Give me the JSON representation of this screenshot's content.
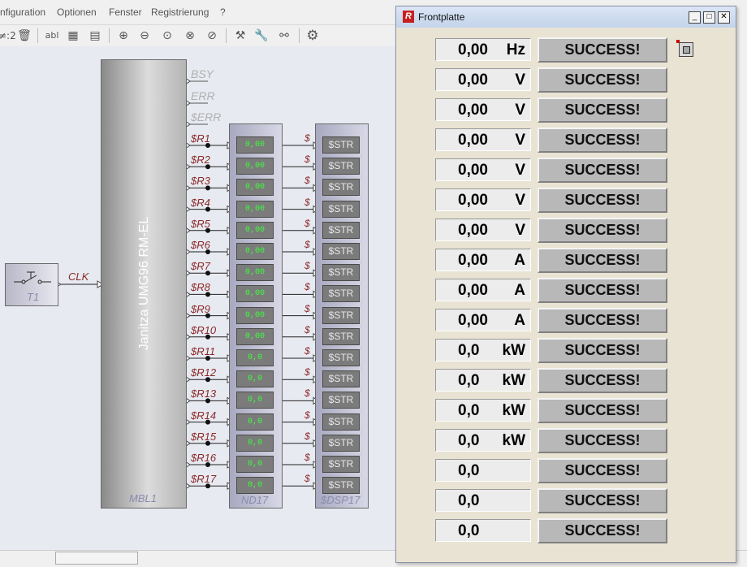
{
  "menubar": {
    "items": [
      "nfiguration",
      "Optionen",
      "Fenster",
      "Registrierung",
      "?"
    ]
  },
  "toolbar": {
    "zoom_label": "≠:2",
    "text_tool_label": "abl"
  },
  "canvas": {
    "switch_block": {
      "label": "T1",
      "output": "CLK"
    },
    "main_block": {
      "title": "Janitza UMG96 RM-EL",
      "label": "MBL1"
    },
    "status_signals": [
      "BSY",
      "ERR",
      "$ERR"
    ],
    "output_signals": [
      "$R1",
      "$R2",
      "$R3",
      "$R4",
      "$R5",
      "$R6",
      "$R7",
      "$R8",
      "$R9",
      "$R10",
      "$R11",
      "$R12",
      "$R13",
      "$R14",
      "$R15",
      "$R16",
      "$R17"
    ],
    "nd_block": {
      "label": "ND17",
      "cells": [
        "0,00",
        "0,00",
        "0,00",
        "0,00",
        "0,00",
        "0,00",
        "0,00",
        "0,00",
        "0,00",
        "0,00",
        "0,0",
        "0,0",
        "0,0",
        "0,0",
        "0,0",
        "0,0",
        "0,0"
      ]
    },
    "dsp_block": {
      "label": "$DSP17",
      "cell_text": "$STR",
      "input_label": "$"
    }
  },
  "frontplatte": {
    "title": "Frontplatte",
    "window_buttons": {
      "minimize": "_",
      "maximize": "□",
      "close": "✕"
    },
    "rows": [
      {
        "value": "0,00",
        "unit": "Hz",
        "status": "SUCCESS!"
      },
      {
        "value": "0,00",
        "unit": "V",
        "status": "SUCCESS!"
      },
      {
        "value": "0,00",
        "unit": "V",
        "status": "SUCCESS!"
      },
      {
        "value": "0,00",
        "unit": "V",
        "status": "SUCCESS!"
      },
      {
        "value": "0,00",
        "unit": "V",
        "status": "SUCCESS!"
      },
      {
        "value": "0,00",
        "unit": "V",
        "status": "SUCCESS!"
      },
      {
        "value": "0,00",
        "unit": "V",
        "status": "SUCCESS!"
      },
      {
        "value": "0,00",
        "unit": "A",
        "status": "SUCCESS!"
      },
      {
        "value": "0,00",
        "unit": "A",
        "status": "SUCCESS!"
      },
      {
        "value": "0,00",
        "unit": "A",
        "status": "SUCCESS!"
      },
      {
        "value": "0,0",
        "unit": "kW",
        "status": "SUCCESS!"
      },
      {
        "value": "0,0",
        "unit": "kW",
        "status": "SUCCESS!"
      },
      {
        "value": "0,0",
        "unit": "kW",
        "status": "SUCCESS!"
      },
      {
        "value": "0,0",
        "unit": "kW",
        "status": "SUCCESS!"
      },
      {
        "value": "0,0",
        "unit": "",
        "status": "SUCCESS!"
      },
      {
        "value": "0,0",
        "unit": "",
        "status": "SUCCESS!"
      },
      {
        "value": "0,0",
        "unit": "",
        "status": "SUCCESS!"
      }
    ]
  }
}
